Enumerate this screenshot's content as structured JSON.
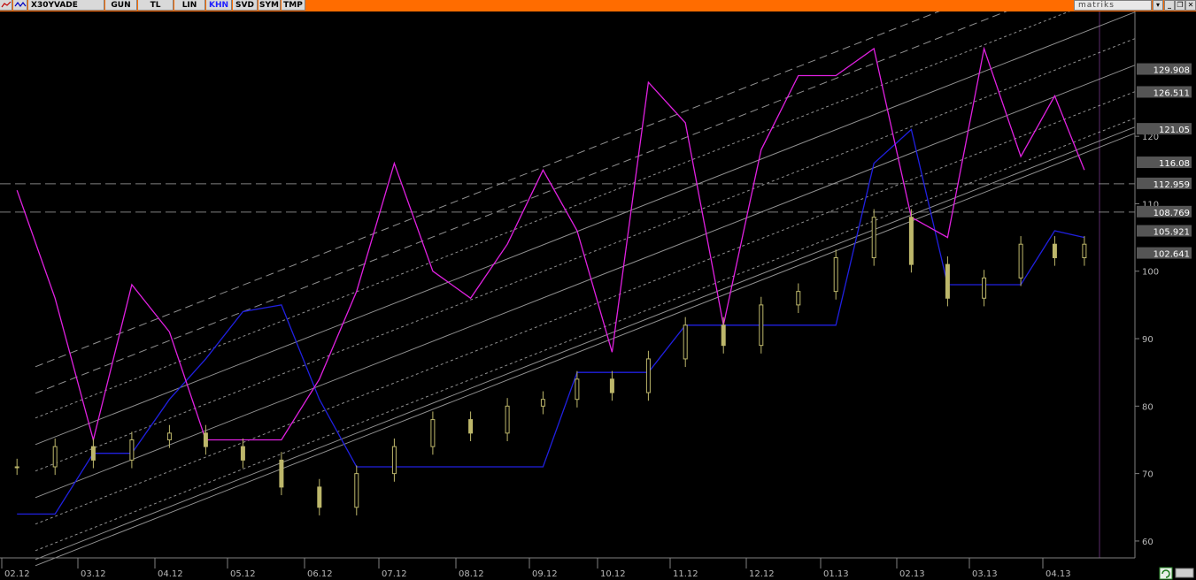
{
  "toolbar": {
    "symbol": "X30YVADE",
    "buttons": [
      {
        "label": "GUN",
        "active": false
      },
      {
        "label": "TL",
        "active": false
      },
      {
        "label": "LIN",
        "active": false
      },
      {
        "label": "KHN",
        "active": true
      },
      {
        "label": "SVD",
        "active": false
      },
      {
        "label": "SYM",
        "active": false
      },
      {
        "label": "TMP",
        "active": false
      }
    ],
    "brand": "matriks",
    "window_buttons": [
      "dropdown-icon",
      "minimize-icon",
      "restore-icon",
      "close-icon"
    ]
  },
  "colors": {
    "toolbar_bg": "#ff6c00",
    "background": "#000000",
    "price": "#bdb76b",
    "indicator_magenta": "#e020e0",
    "indicator_blue": "#2020e0",
    "channel": "#c0c0c0",
    "axis_text": "#b8b8b8"
  },
  "chart_data": {
    "type": "candlestick",
    "y_axis": {
      "ticks": [
        60,
        70,
        80,
        90,
        100,
        110,
        120
      ],
      "ylim": [
        57.5,
        138.5
      ]
    },
    "x_axis": {
      "labels": [
        "02.12",
        "03.12",
        "04.12",
        "05.12",
        "06.12",
        "07.12",
        "08.12",
        "09.12",
        "10.12",
        "11.12",
        "12.12",
        "01.13",
        "02.13",
        "03.13",
        "04.13"
      ]
    },
    "level_labels": [
      "129.908",
      "126.511",
      "121.05",
      "116.08",
      "112.959",
      "108.769",
      "105.921",
      "102.641"
    ],
    "horizontal_levels": [
      112.959,
      108.769
    ],
    "close_series": [
      {
        "d": "02.12",
        "v": 71
      },
      {
        "d": "02.12",
        "v": 74
      },
      {
        "d": "03.12",
        "v": 72
      },
      {
        "d": "03.12",
        "v": 75
      },
      {
        "d": "04.12",
        "v": 76
      },
      {
        "d": "04.12",
        "v": 74
      },
      {
        "d": "05.12",
        "v": 72
      },
      {
        "d": "05.12",
        "v": 68
      },
      {
        "d": "06.12",
        "v": 65
      },
      {
        "d": "06.12",
        "v": 70
      },
      {
        "d": "07.12",
        "v": 74
      },
      {
        "d": "07.12",
        "v": 78
      },
      {
        "d": "08.12",
        "v": 76
      },
      {
        "d": "08.12",
        "v": 80
      },
      {
        "d": "09.12",
        "v": 81
      },
      {
        "d": "09.12",
        "v": 84
      },
      {
        "d": "10.12",
        "v": 82
      },
      {
        "d": "10.12",
        "v": 87
      },
      {
        "d": "11.12",
        "v": 92
      },
      {
        "d": "11.12",
        "v": 89
      },
      {
        "d": "12.12",
        "v": 95
      },
      {
        "d": "12.12",
        "v": 97
      },
      {
        "d": "01.13",
        "v": 102
      },
      {
        "d": "01.13",
        "v": 108
      },
      {
        "d": "02.13",
        "v": 101
      },
      {
        "d": "02.13",
        "v": 96
      },
      {
        "d": "03.13",
        "v": 99
      },
      {
        "d": "03.13",
        "v": 104
      },
      {
        "d": "04.13",
        "v": 102
      },
      {
        "d": "04.13",
        "v": 104
      }
    ],
    "indicator_magenta": [
      {
        "d": "02.12",
        "v": 112
      },
      {
        "d": "02.12",
        "v": 96
      },
      {
        "d": "03.12",
        "v": 75
      },
      {
        "d": "03.12",
        "v": 98
      },
      {
        "d": "04.12",
        "v": 91
      },
      {
        "d": "04.12",
        "v": 75
      },
      {
        "d": "05.12",
        "v": 75
      },
      {
        "d": "05.12",
        "v": 75
      },
      {
        "d": "06.12",
        "v": 84
      },
      {
        "d": "06.12",
        "v": 97
      },
      {
        "d": "07.12",
        "v": 116
      },
      {
        "d": "07.12",
        "v": 100
      },
      {
        "d": "08.12",
        "v": 96
      },
      {
        "d": "08.12",
        "v": 104
      },
      {
        "d": "09.12",
        "v": 115
      },
      {
        "d": "09.12",
        "v": 106
      },
      {
        "d": "10.12",
        "v": 88
      },
      {
        "d": "10.12",
        "v": 128
      },
      {
        "d": "11.12",
        "v": 122
      },
      {
        "d": "11.12",
        "v": 92
      },
      {
        "d": "12.12",
        "v": 118
      },
      {
        "d": "12.12",
        "v": 129
      },
      {
        "d": "01.13",
        "v": 129
      },
      {
        "d": "01.13",
        "v": 133
      },
      {
        "d": "02.13",
        "v": 108
      },
      {
        "d": "02.13",
        "v": 105
      },
      {
        "d": "03.13",
        "v": 133
      },
      {
        "d": "03.13",
        "v": 117
      },
      {
        "d": "04.13",
        "v": 126
      },
      {
        "d": "04.13",
        "v": 115
      }
    ],
    "indicator_blue": [
      {
        "d": "02.12",
        "v": 64
      },
      {
        "d": "02.12",
        "v": 64
      },
      {
        "d": "03.12",
        "v": 73
      },
      {
        "d": "03.12",
        "v": 73
      },
      {
        "d": "04.12",
        "v": 81
      },
      {
        "d": "04.12",
        "v": 87
      },
      {
        "d": "05.12",
        "v": 94
      },
      {
        "d": "05.12",
        "v": 95
      },
      {
        "d": "06.12",
        "v": 81
      },
      {
        "d": "06.12",
        "v": 71
      },
      {
        "d": "07.12",
        "v": 71
      },
      {
        "d": "07.12",
        "v": 71
      },
      {
        "d": "08.12",
        "v": 71
      },
      {
        "d": "08.12",
        "v": 71
      },
      {
        "d": "09.12",
        "v": 71
      },
      {
        "d": "09.12",
        "v": 85
      },
      {
        "d": "10.12",
        "v": 85
      },
      {
        "d": "10.12",
        "v": 85
      },
      {
        "d": "11.12",
        "v": 92
      },
      {
        "d": "11.12",
        "v": 92
      },
      {
        "d": "12.12",
        "v": 92
      },
      {
        "d": "12.12",
        "v": 92
      },
      {
        "d": "01.13",
        "v": 92
      },
      {
        "d": "01.13",
        "v": 116
      },
      {
        "d": "02.13",
        "v": 121
      },
      {
        "d": "02.13",
        "v": 98
      },
      {
        "d": "03.13",
        "v": 98
      },
      {
        "d": "03.13",
        "v": 98
      },
      {
        "d": "04.13",
        "v": 106
      },
      {
        "d": "04.13",
        "v": 105
      }
    ]
  }
}
